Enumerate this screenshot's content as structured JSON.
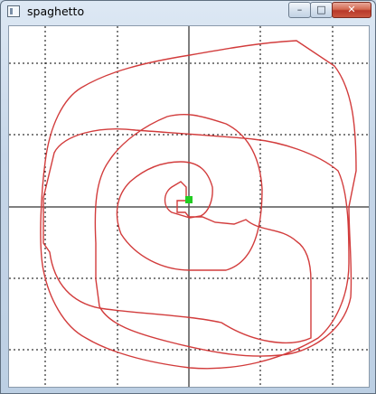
{
  "window": {
    "title": "spaghetto",
    "controls": {
      "minimize_glyph": "–",
      "maximize_glyph": "□",
      "close_glyph": "✕"
    }
  },
  "plot": {
    "grid": "dotted",
    "curve_color": "#d23c3c",
    "axis_color": "#555555",
    "marker_color": "#22cc22",
    "curve_shape": "red spiral path unwinding from the green marker at the center"
  }
}
